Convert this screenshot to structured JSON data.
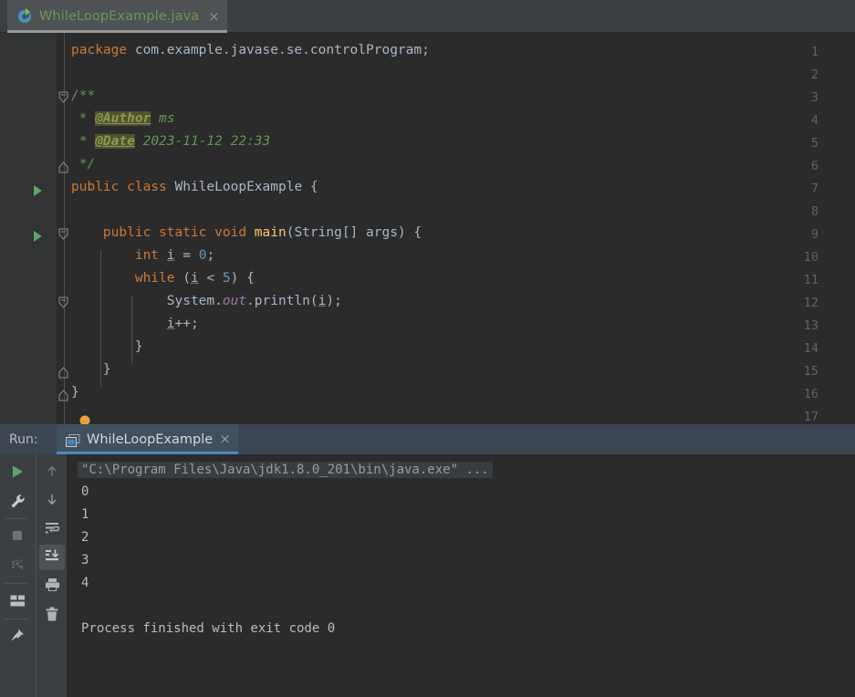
{
  "window": {
    "background": "#2b2b2b",
    "panel_background": "#3c3f41"
  },
  "tabbar": {
    "active_tab": {
      "label": "WhileLoopExample.java",
      "icon": "java-class-run-icon",
      "close": "×",
      "label_color": "#6a9955"
    }
  },
  "editor": {
    "gutter_background": "#313335",
    "line_numbers": [
      "1",
      "2",
      "3",
      "4",
      "5",
      "6",
      "7",
      "8",
      "9",
      "10",
      "11",
      "12",
      "13",
      "14",
      "15",
      "16",
      "17"
    ],
    "run_marker_lines": [
      7,
      9
    ],
    "lightbulb_line": 16,
    "lines": [
      {
        "n": 1,
        "text": "package com.example.javase.se.controlProgram;"
      },
      {
        "n": 2,
        "text": ""
      },
      {
        "n": 3,
        "text": "/**"
      },
      {
        "n": 4,
        "text": " * @Author ms"
      },
      {
        "n": 5,
        "text": " * @Date 2023-11-12 22:33"
      },
      {
        "n": 6,
        "text": " */"
      },
      {
        "n": 7,
        "text": "public class WhileLoopExample {"
      },
      {
        "n": 8,
        "text": ""
      },
      {
        "n": 9,
        "text": "    public static void main(String[] args) {"
      },
      {
        "n": 10,
        "text": "        int i = 0;"
      },
      {
        "n": 11,
        "text": "        while (i < 5) {"
      },
      {
        "n": 12,
        "text": "            System.out.println(i);"
      },
      {
        "n": 13,
        "text": "            i++;"
      },
      {
        "n": 14,
        "text": "        }"
      },
      {
        "n": 15,
        "text": "    }"
      },
      {
        "n": 16,
        "text": "}"
      },
      {
        "n": 17,
        "text": ""
      }
    ],
    "javadoc": {
      "author_tag": "@Author",
      "author_value": "ms",
      "date_tag": "@Date",
      "date_value": "2023-11-12 22:33"
    },
    "colors": {
      "keyword": "#cc7832",
      "string": "#6a8759",
      "number": "#6897bb",
      "comment": "#629755",
      "doc_tag_highlight": "#52502f",
      "field": "#9876aa",
      "text": "#a9b7c6"
    }
  },
  "run_panel": {
    "header_label": "Run:",
    "tab": {
      "label": "WhileLoopExample",
      "icon": "console-window-icon",
      "close": "×",
      "underline_color": "#4a88c7"
    },
    "toolbar_left": [
      {
        "name": "rerun-button",
        "icon": "green-play-icon"
      },
      {
        "name": "edit-configurations-button",
        "icon": "wrench-icon"
      },
      {
        "name": "stop-button",
        "icon": "stop-square-icon"
      },
      {
        "name": "dump-threads-button",
        "icon": "thread-dump-icon"
      },
      {
        "name": "layout-button",
        "icon": "restore-layout-icon"
      },
      {
        "name": "pin-tab-button",
        "icon": "pin-icon"
      }
    ],
    "toolbar_right": [
      {
        "name": "up-the-stack-trace-button",
        "icon": "arrow-up-icon",
        "active": false
      },
      {
        "name": "down-the-stack-trace-button",
        "icon": "arrow-down-icon",
        "active": false
      },
      {
        "name": "soft-wrap-button",
        "icon": "soft-wrap-icon",
        "active": false
      },
      {
        "name": "scroll-to-end-button",
        "icon": "scroll-to-end-icon",
        "active": true
      },
      {
        "name": "print-button",
        "icon": "printer-icon",
        "active": false
      },
      {
        "name": "clear-all-button",
        "icon": "trash-icon",
        "active": false
      }
    ],
    "console": {
      "command_line": "\"C:\\Program Files\\Java\\jdk1.8.0_201\\bin\\java.exe\" ...",
      "output": [
        "0",
        "1",
        "2",
        "3",
        "4"
      ],
      "blank_line": "",
      "exit_message": "Process finished with exit code 0"
    }
  }
}
